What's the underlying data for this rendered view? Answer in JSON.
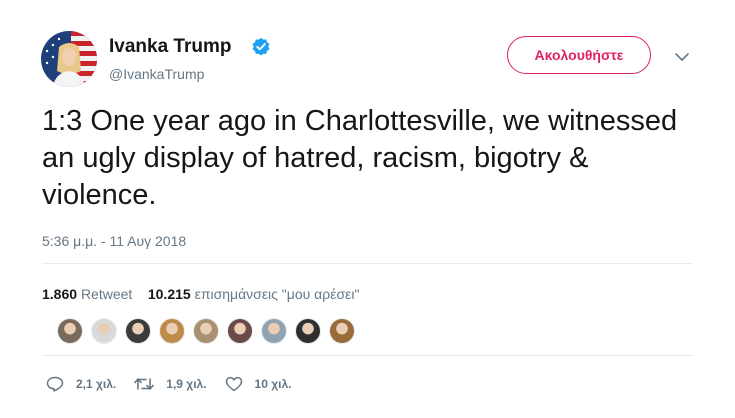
{
  "author": {
    "name": "Ivanka Trump",
    "handle": "@IvankaTrump",
    "verified_icon": "verified-badge-icon",
    "avatar_icon": "profile-photo-avatar"
  },
  "header": {
    "follow_label": "Ακολουθήστε",
    "more_icon": "chevron-down-icon"
  },
  "tweet": {
    "text": "1:3 One year ago in Charlottesville, we witnessed an ugly display of hatred, racism, bigotry & violence.",
    "timestamp": "5:36 μ.μ. - 11 Αυγ 2018"
  },
  "stats": {
    "retweet_count": "1.860",
    "retweet_label": "Retweet",
    "like_count": "10.215",
    "like_label": "επισημάνσεις \"μου αρέσει\""
  },
  "likers": {
    "count_shown": 9,
    "colors": [
      "#7a6a5c",
      "#d9d9d9",
      "#3b3b3b",
      "#c08a4a",
      "#a89070",
      "#6b4a4a",
      "#8fa3b3",
      "#2f2f2f",
      "#9a6a3a"
    ]
  },
  "actions": {
    "reply_count": "2,1 χιλ.",
    "retweet_count": "1,9 χιλ.",
    "like_count": "10 χιλ."
  },
  "colors": {
    "accent_follow": "#e0245e",
    "verified_blue": "#1da1f2",
    "secondary_text": "#657786",
    "primary_text": "#14171a",
    "divider": "#e6ecf0"
  }
}
